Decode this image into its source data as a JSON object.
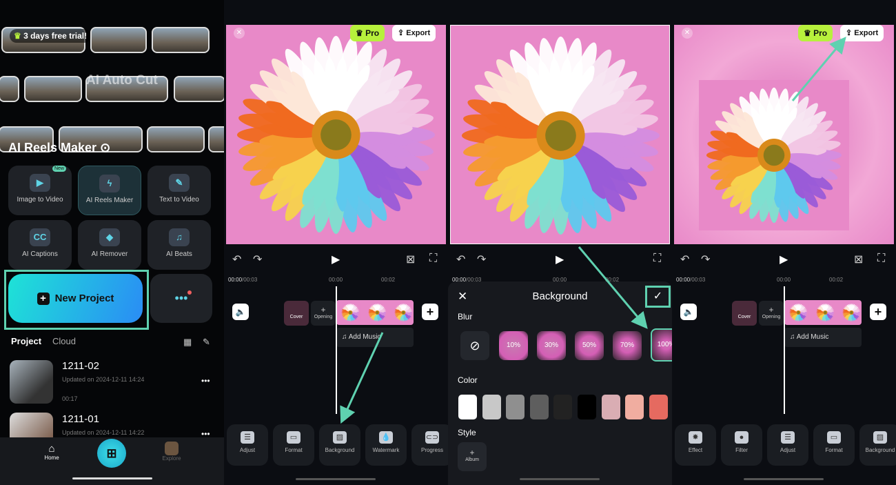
{
  "home": {
    "trial": "3 days free trial!",
    "auto_cut": "AI Auto Cut",
    "reels_title": "AI Reels Maker",
    "tools": [
      {
        "label": "Image to Video",
        "icon": "image-to-video-icon",
        "glyph": "▶",
        "badge": "New"
      },
      {
        "label": "AI Reels Maker",
        "icon": "lightning-icon",
        "glyph": "ϟ"
      },
      {
        "label": "Text  to Video",
        "icon": "pen-icon",
        "glyph": "✎"
      },
      {
        "label": "AI Captions",
        "icon": "cc-icon",
        "glyph": "CC"
      },
      {
        "label": "AI Remover",
        "icon": "eraser-icon",
        "glyph": "◆"
      },
      {
        "label": "AI Beats",
        "icon": "music-beats-icon",
        "glyph": "♫"
      }
    ],
    "new_project": "New Project",
    "tabs": [
      "Project",
      "Cloud"
    ],
    "projects": [
      {
        "name": "1211-02",
        "updated": "Updated on 2024-12-11 14:24",
        "duration": "00:17"
      },
      {
        "name": "1211-01",
        "updated": "Updated on 2024-12-11 14:22"
      }
    ],
    "nav": {
      "home": "Home",
      "explore": "Explore"
    },
    "highlight_color": "#5fd1b0"
  },
  "editor": {
    "pro": "Pro",
    "export": "Export",
    "time": "00:00",
    "total": "/00:03",
    "ticks": [
      "00:00",
      "00:02"
    ],
    "cover": "Cover",
    "opening": "Opening",
    "add_music": "Add Music",
    "tools_a": [
      "Adjust",
      "Format",
      "Background",
      "Watermark",
      "Progress"
    ],
    "tools_b": [
      "Effect",
      "Filter",
      "Adjust",
      "Format",
      "Background"
    ]
  },
  "background_sheet": {
    "title": "Background",
    "blur_label": "Blur",
    "blur_options": [
      "10%",
      "30%",
      "50%",
      "70%",
      "100%"
    ],
    "selected_blur": "100%",
    "color_label": "Color",
    "colors": [
      "#ffffff",
      "#c8c8c8",
      "#8f8f8f",
      "#5e5e5e",
      "#222222",
      "#000000",
      "#d9adb3",
      "#f0ada0",
      "#e56a60"
    ],
    "style_label": "Style",
    "album": "Album"
  },
  "colors": {
    "accent": "#5fd1b0",
    "preview_bg": "#e889c8",
    "pro": "#b7f03c"
  }
}
